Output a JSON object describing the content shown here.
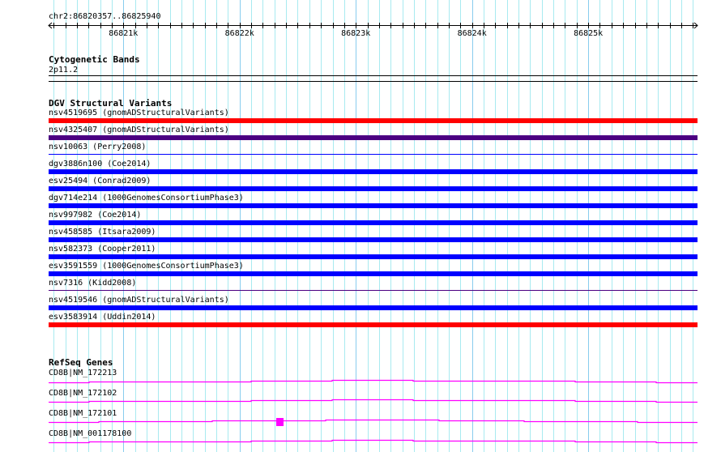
{
  "ruler": {
    "region_label": "chr2:86820357..86825940",
    "start": 86820357,
    "end": 86825940,
    "tick_labels": [
      {
        "pos": 86821000,
        "label": "86821k"
      },
      {
        "pos": 86822000,
        "label": "86822k"
      },
      {
        "pos": 86823000,
        "label": "86823k"
      },
      {
        "pos": 86824000,
        "label": "86824k"
      },
      {
        "pos": 86825000,
        "label": "86825k"
      }
    ]
  },
  "cytobands": {
    "title": "Cytogenetic Bands",
    "band": "2p11.2"
  },
  "dgv": {
    "title": "DGV Structural Variants",
    "items": [
      {
        "label": "nsv4519695 (gnomADStructuralVariants)",
        "color": "#ff0000",
        "style": "thick"
      },
      {
        "label": "nsv4325407 (gnomADStructuralVariants)",
        "color": "#4b0082",
        "style": "thick"
      },
      {
        "label": "nsv10063 (Perry2008)",
        "color": "#0000ff",
        "style": "thin"
      },
      {
        "label": "dgv3886n100 (Coe2014)",
        "color": "#0000ff",
        "style": "thick"
      },
      {
        "label": "esv25494 (Conrad2009)",
        "color": "#0000ff",
        "style": "thick"
      },
      {
        "label": "dgv714e214 (1000GenomesConsortiumPhase3)",
        "color": "#0000ff",
        "style": "thick"
      },
      {
        "label": "nsv997982 (Coe2014)",
        "color": "#0000ff",
        "style": "thick"
      },
      {
        "label": "nsv458585 (Itsara2009)",
        "color": "#0000ff",
        "style": "thick"
      },
      {
        "label": "nsv582373 (Cooper2011)",
        "color": "#0000ff",
        "style": "thick"
      },
      {
        "label": "esv3591559 (1000GenomesConsortiumPhase3)",
        "color": "#0000ff",
        "style": "thick"
      },
      {
        "label": "nsv7316 (Kidd2008)",
        "color": "#4b0082",
        "style": "thin"
      },
      {
        "label": "nsv4519546 (gnomADStructuralVariants)",
        "color": "#0000ff",
        "style": "thick"
      },
      {
        "label": "esv3583914 (Uddin2014)",
        "color": "#ff0000",
        "style": "thick"
      }
    ]
  },
  "refseq": {
    "title": "RefSeq Genes",
    "color": "#ff00ff",
    "items": [
      {
        "label": "CD8B|NM_172213"
      },
      {
        "label": "CD8B|NM_172102"
      },
      {
        "label": "CD8B|NM_172101",
        "exon_marker": true
      },
      {
        "label": "CD8B|NM_001178100"
      }
    ]
  }
}
